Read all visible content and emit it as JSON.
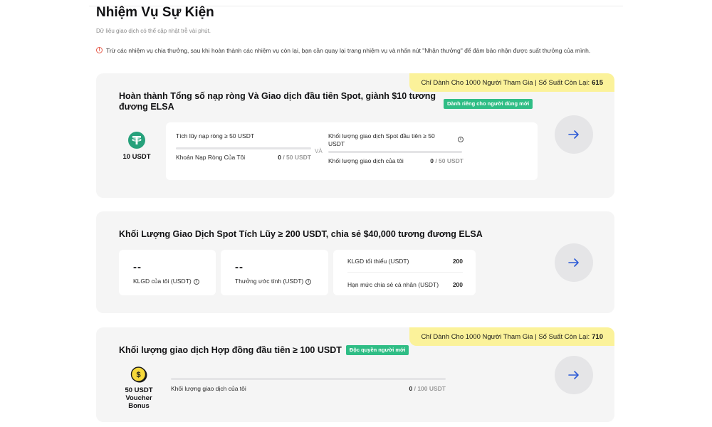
{
  "header": {
    "title": "Nhiệm Vụ Sự Kiện",
    "subtitle": "Dữ liệu giao dịch có thể cập nhật trễ vài phút.",
    "notice": "Trừ các nhiệm vụ chia thưởng, sau khi hoàn thành các nhiệm vụ còn lại, bạn cần quay lại trang nhiệm vụ và nhấn nút \"Nhận thưởng\" để đảm bảo nhận được suất thưởng của mình."
  },
  "task1": {
    "banner_text": "Chỉ Dành Cho 1000 Người Tham Gia | Số Suất Còn Lại:",
    "banner_count": "615",
    "title": "Hoàn thành Tổng số nạp ròng Và Giao dịch đầu tiên Spot, giành $10 tương đương ELSA",
    "badge": "Dành riêng cho người dùng mới",
    "reward_label": "10 USDT",
    "cond1": {
      "label": "Tích lũy nạp ròng ≥ 50 USDT",
      "progress_label": "Khoản Nạp Ròng Của Tôi",
      "current": "0",
      "target": "/ 50 USDT"
    },
    "connector": "VÀ",
    "cond2": {
      "label": "Khối lượng giao dịch Spot đầu tiên ≥ 50 USDT",
      "progress_label": "Khối lượng giao dịch của tôi",
      "current": "0",
      "target": "/ 50 USDT"
    }
  },
  "task2": {
    "title": "Khối Lượng Giao Dịch Spot Tích Lũy ≥ 200 USDT, chia sẻ $40,000 tương đương ELSA",
    "stat1": {
      "value": "--",
      "label": "KLGD của tôi (USDT)"
    },
    "stat2": {
      "value": "--",
      "label": "Thưởng ước tính (USDT)"
    },
    "details": [
      {
        "label": "KLGD tối thiểu (USDT)",
        "value": "200"
      },
      {
        "label": "Hạn mức chia sẻ cá nhân (USDT)",
        "value": "200"
      }
    ]
  },
  "task3": {
    "banner_text": "Chỉ Dành Cho 1000 Người Tham Gia | Số Suất Còn Lại:",
    "banner_count": "710",
    "title": "Khối lượng giao dịch Hợp đồng đầu tiên ≥ 100 USDT",
    "badge": "Độc quyền người mới",
    "reward_label_line1": "50 USDT",
    "reward_label_line2": "Voucher",
    "reward_label_line3": "Bonus",
    "progress_label": "Khối lượng giao dịch của tôi",
    "current": "0",
    "target": "/ 100 USDT"
  },
  "icons": {
    "tether": "tether-icon",
    "voucher": "dollar-coin-icon",
    "arrow": "arrow-right-icon",
    "info": "info-icon",
    "warning": "warning-icon"
  },
  "colors": {
    "accent_blue": "#2d5bd6",
    "badge_green": "#2fbd85",
    "banner_yellow": "#fbf29a",
    "tether_green": "#26a17b",
    "coin_yellow": "#f7d93a"
  }
}
